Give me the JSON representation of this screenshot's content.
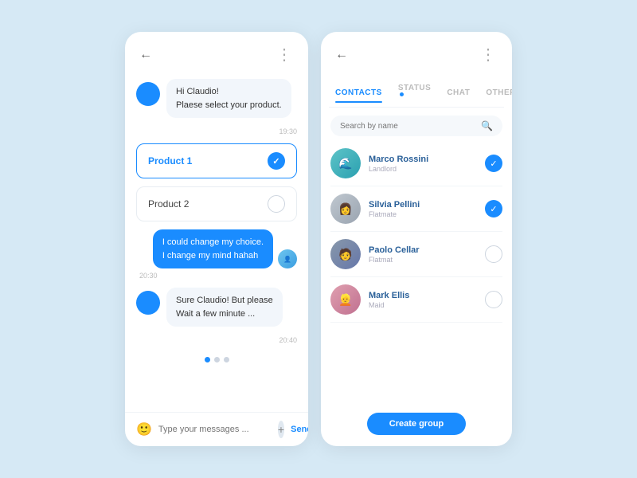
{
  "left": {
    "back_label": "←",
    "more_label": "⋮",
    "messages": [
      {
        "type": "received",
        "text": "Hi Claudio!\nPlaese select your product.",
        "time": "19:30"
      }
    ],
    "products": [
      {
        "label": "Product 1",
        "selected": true
      },
      {
        "label": "Product 2",
        "selected": false
      }
    ],
    "blue_message": "I could change my choice.\nI change my mind hahah",
    "blue_time": "20:30",
    "received_message": "Sure Claudio! But please\nWait a few minute ...",
    "received_time": "20:40",
    "input_placeholder": "Type your messages ...",
    "send_label": "Send"
  },
  "right": {
    "back_label": "←",
    "more_label": "⋮",
    "tabs": [
      {
        "label": "CONTACTS",
        "active": true,
        "badge": false
      },
      {
        "label": "STATUS",
        "active": false,
        "badge": true
      },
      {
        "label": "CHAT",
        "active": false,
        "badge": false
      },
      {
        "label": "OTHERS",
        "active": false,
        "badge": false
      }
    ],
    "search_placeholder": "Search by name",
    "contacts": [
      {
        "name": "Marco Rossini",
        "sub": "Landlord",
        "checked": true,
        "avatar_color": "teal"
      },
      {
        "name": "Silvia Pellini",
        "sub": "Flatmate",
        "checked": true,
        "avatar_color": "gray"
      },
      {
        "name": "Paolo Cellar",
        "sub": "Flatmat",
        "checked": false,
        "avatar_color": "slate"
      },
      {
        "name": "Mark Ellis",
        "sub": "Maid",
        "checked": false,
        "avatar_color": "pink"
      }
    ],
    "create_group_label": "Create group"
  }
}
